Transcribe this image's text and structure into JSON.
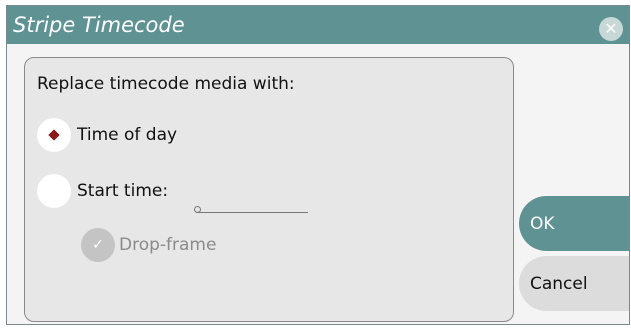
{
  "dialog": {
    "title": "Stripe Timecode",
    "close_icon_glyph": "✕"
  },
  "panel": {
    "prompt": "Replace timecode media with:",
    "options": [
      {
        "label": "Time of day",
        "selected": true
      },
      {
        "label": "Start time:",
        "selected": false
      }
    ],
    "start_time_value": "",
    "drop_frame": {
      "label": "Drop-frame",
      "checked": true,
      "enabled": false,
      "check_glyph": "✓"
    }
  },
  "buttons": {
    "ok_label": "OK",
    "cancel_label": "Cancel"
  },
  "colors": {
    "titlebar": "#5e9293",
    "ok_button": "#5e9293",
    "radio_selected_dot": "#8b1a1a",
    "dialog_background": "#f4f4f4",
    "panel_background": "#e7e7e7"
  },
  "icons": {
    "close": "close-icon",
    "radio_selected": "radio-selected-icon",
    "check": "check-icon"
  }
}
